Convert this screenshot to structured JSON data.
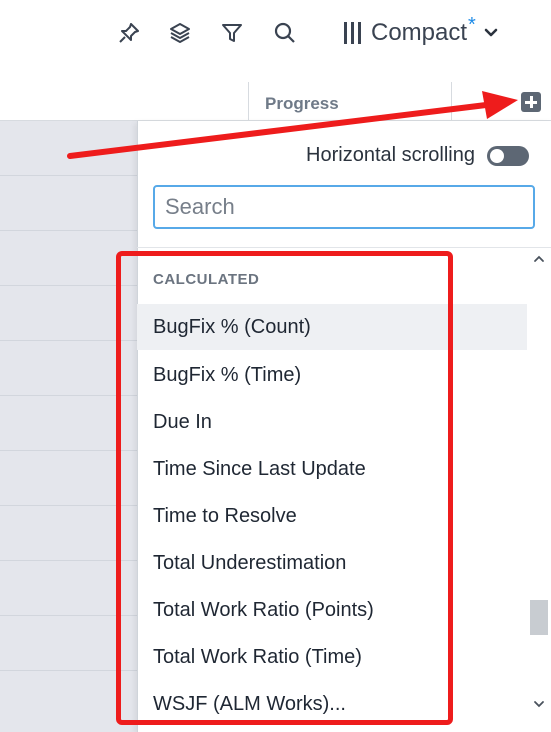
{
  "toolbar": {
    "icons": [
      "pin-icon",
      "layers-icon",
      "filter-icon",
      "search-icon"
    ],
    "view_label": "Compact",
    "view_modified_marker": "*"
  },
  "grid": {
    "progress_column_label": "Progress"
  },
  "column_picker": {
    "horizontal_scrolling_label": "Horizontal scrolling",
    "horizontal_scrolling_enabled": false,
    "search_placeholder": "Search",
    "search_value": "",
    "section_label": "CALCULATED",
    "items": [
      {
        "label": "BugFix % (Count)",
        "highlighted": true
      },
      {
        "label": "BugFix % (Time)",
        "highlighted": false
      },
      {
        "label": "Due In",
        "highlighted": false
      },
      {
        "label": "Time Since Last Update",
        "highlighted": false
      },
      {
        "label": "Time to Resolve",
        "highlighted": false
      },
      {
        "label": "Total Underestimation",
        "highlighted": false
      },
      {
        "label": "Total Work Ratio (Points)",
        "highlighted": false
      },
      {
        "label": "Total Work Ratio (Time)",
        "highlighted": false
      },
      {
        "label": "WSJF (ALM Works)...",
        "highlighted": false
      }
    ]
  },
  "colors": {
    "accent": "#1e8be7",
    "annotation_red": "#ee1c1c",
    "text_dark": "#2b333e",
    "highlight_row": "#eef0f3"
  }
}
